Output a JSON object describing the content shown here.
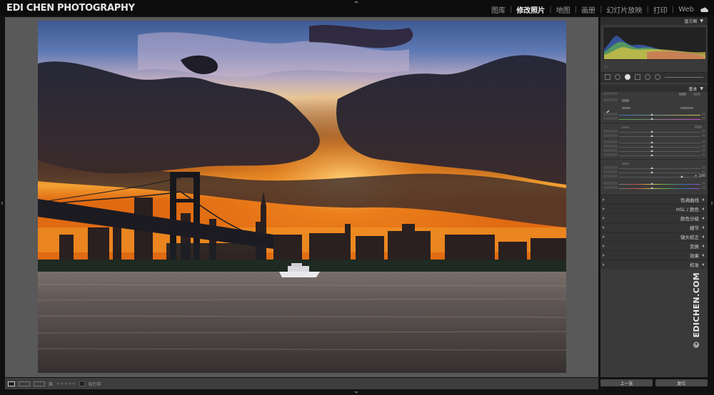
{
  "app": {
    "brand": "EDI CHEN PHOTOGRAPHY",
    "modules": [
      {
        "label": "图库",
        "active": false
      },
      {
        "label": "修改照片",
        "active": true
      },
      {
        "label": "地图",
        "active": false
      },
      {
        "label": "画册",
        "active": false
      },
      {
        "label": "幻灯片放映",
        "active": false
      },
      {
        "label": "打印",
        "active": false
      },
      {
        "label": "Web",
        "active": false
      }
    ],
    "accent_active": "#f0f0f0",
    "icons": {
      "cloud": "cloud-icon"
    }
  },
  "photo": {
    "subject": "Williamsburg Bridge and skyline at sunset with storm clouds over the river",
    "boat": "white ferry on the river"
  },
  "toolbar": {
    "view_modes": [
      "loupe-icon",
      "compare-icon",
      "survey-icon"
    ],
    "flag_label": "旗",
    "rating_stars": 5,
    "soft_proof_label": "软打样"
  },
  "right_panel": {
    "histogram_label": "直方图",
    "basic_label": "基本",
    "basic_vibrance_value": "+ 100",
    "sections": [
      "色调曲线",
      "HSL / 颜色",
      "颜色分级",
      "细节",
      "镜头校正",
      "变换",
      "效果",
      "校准"
    ],
    "previous_button": "上一张",
    "reset_button": "复位"
  },
  "watermark": "© EDICHEN.COM"
}
